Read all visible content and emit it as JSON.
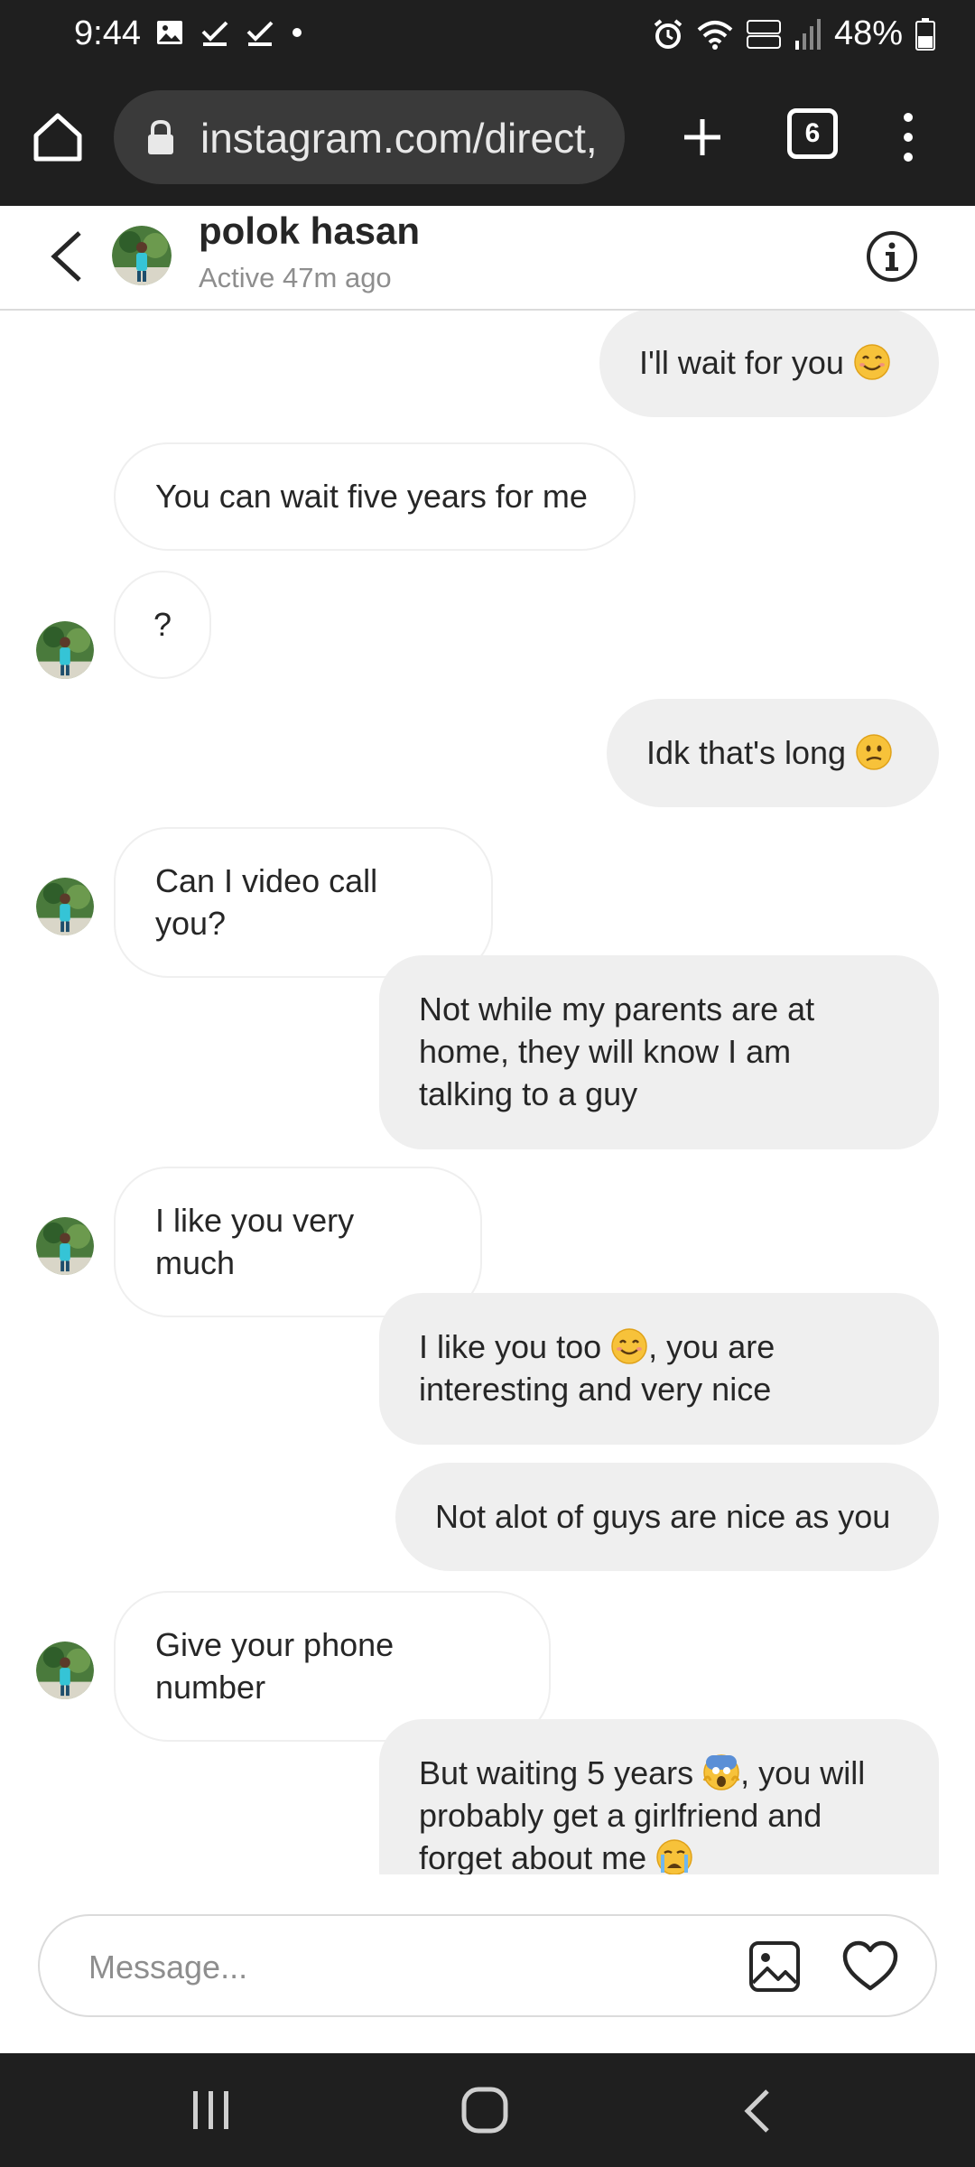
{
  "status_bar": {
    "time": "9:44",
    "battery": "48%"
  },
  "browser": {
    "url": "instagram.com/direct,",
    "tab_count": "6"
  },
  "header": {
    "name": "polok hasan",
    "status": "Active 47m ago"
  },
  "messages": [
    {
      "dir": "out",
      "text": "I'll wait for you",
      "emoji": "smiling-face-icon"
    },
    {
      "dir": "in",
      "text": "You can wait five years for me"
    },
    {
      "dir": "in",
      "text": "?"
    },
    {
      "dir": "out",
      "text": "Idk that's long",
      "emoji": "confused-face-icon"
    },
    {
      "dir": "in",
      "text": "Can I video call you?"
    },
    {
      "dir": "out",
      "lines": [
        "Not while my parents are at",
        "home, they will know I am",
        "talking to a guy"
      ]
    },
    {
      "dir": "in",
      "text": "I like you very much"
    },
    {
      "dir": "out",
      "line1_pre": "I like you too",
      "line1_post": ", you are",
      "line2": "interesting and very nice"
    },
    {
      "dir": "out",
      "text": "Not alot of guys are nice as you"
    },
    {
      "dir": "in",
      "text": "Give your phone number"
    },
    {
      "dir": "out",
      "line1_pre": "But waiting 5 years",
      "line1_post": ", you will",
      "line2": "probably get a girlfriend and",
      "line3": "forget about me"
    }
  ],
  "composer": {
    "placeholder": "Message..."
  },
  "colors": {
    "bar_bg": "#1f1f1f",
    "bubble_out": "#efefef",
    "text": "#262626",
    "muted": "#8e8e8e"
  }
}
